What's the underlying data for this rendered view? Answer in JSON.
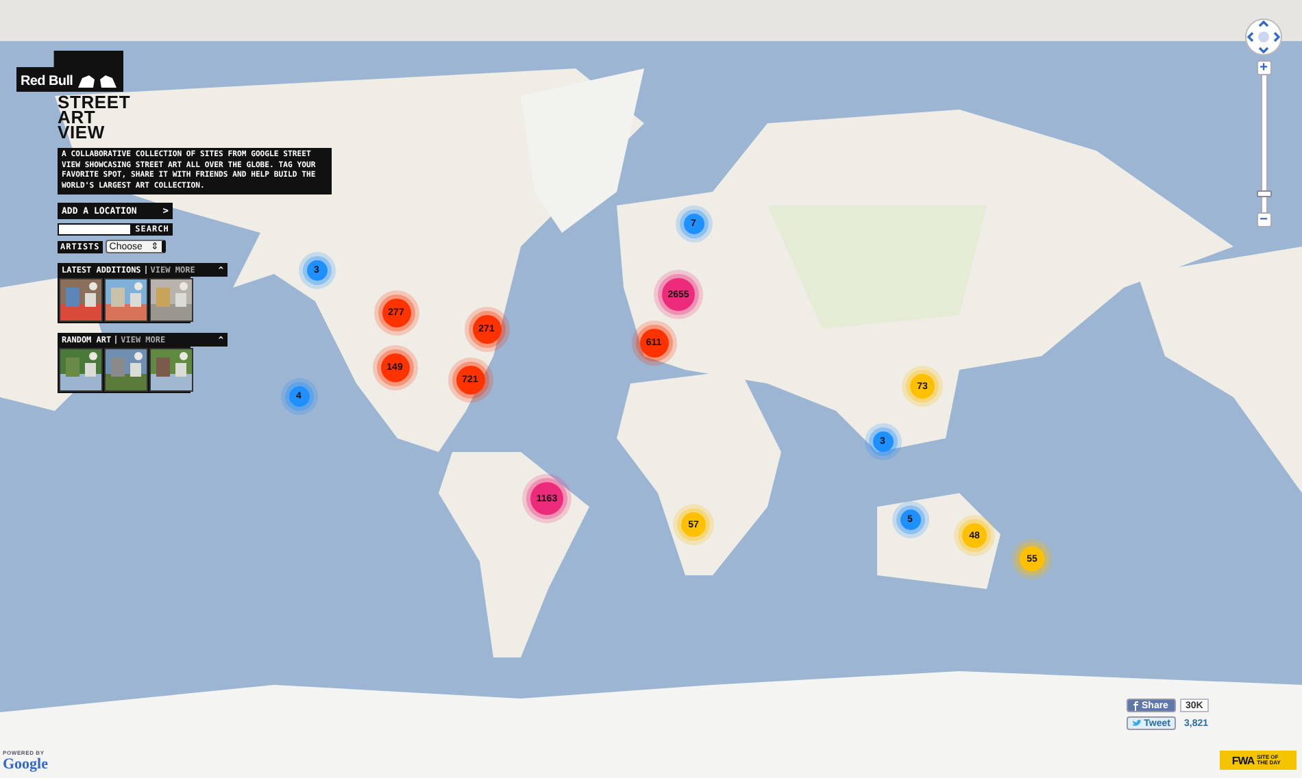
{
  "brand": {
    "logo_text": "Red Bull",
    "title": "STREET ART VIEW",
    "description": "A COLLABORATIVE COLLECTION OF SITES FROM GOOGLE STREET VIEW SHOWCASING STREET ART ALL OVER THE GLOBE. TAG YOUR FAVORITE SPOT, SHARE IT WITH FRIENDS AND HELP BUILD THE WORLD'S LARGEST ART COLLECTION."
  },
  "panel": {
    "add_location": {
      "label": "ADD A LOCATION",
      "arrow": ">"
    },
    "search": {
      "button": "SEARCH"
    },
    "artists": {
      "label": "ARTISTS",
      "value": "Choose",
      "arrows": "⇕"
    },
    "sections": [
      {
        "title": "LATEST ADDITIONS",
        "link": "VIEW MORE",
        "toggle": "^"
      },
      {
        "title": "RANDOM ART",
        "link": "VIEW MORE",
        "toggle": "^"
      }
    ]
  },
  "map": {
    "kind": "picture",
    "clusters": [
      {
        "count": "3",
        "color": "#1e90ff"
      },
      {
        "count": "277",
        "color": "#ff3300"
      },
      {
        "count": "271",
        "color": "#ff3300"
      },
      {
        "count": "149",
        "color": "#ff3300"
      },
      {
        "count": "721",
        "color": "#ff3300"
      },
      {
        "count": "4",
        "color": "#1e90ff"
      },
      {
        "count": "7",
        "color": "#1e90ff"
      },
      {
        "count": "2655",
        "color": "#ee2a7b"
      },
      {
        "count": "611",
        "color": "#ff3300"
      },
      {
        "count": "1163",
        "color": "#ee2a7b"
      },
      {
        "count": "57",
        "color": "#ffc000"
      },
      {
        "count": "73",
        "color": "#ffc000"
      },
      {
        "count": "3",
        "color": "#1e90ff"
      },
      {
        "count": "5",
        "color": "#1e90ff"
      },
      {
        "count": "48",
        "color": "#ffc000"
      },
      {
        "count": "55",
        "color": "#ffc000"
      }
    ],
    "zoom": {
      "plus": "+",
      "minus": "−",
      "level": 0.12
    }
  },
  "attribution": {
    "powered_by": "POWERED BY",
    "logo": "Google"
  },
  "share": {
    "facebook": {
      "label": "Share",
      "count": "30K"
    },
    "twitter": {
      "label": "Tweet",
      "count": "3,821"
    }
  },
  "ribbon": {
    "logo": "FWA",
    "text": "SITE OF THE DAY"
  }
}
